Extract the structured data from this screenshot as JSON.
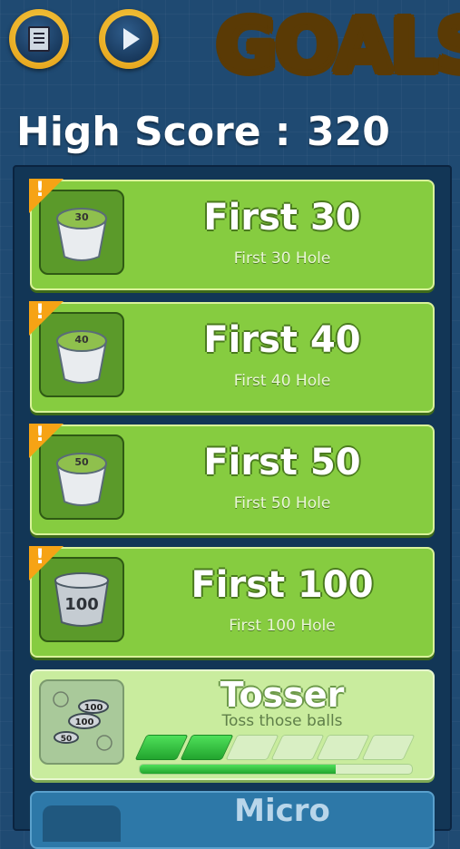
{
  "header": {
    "logo_text": "GOALS",
    "menu_button_icon": "menu-list-icon",
    "play_button_icon": "play-icon"
  },
  "high_score": {
    "label": "High Score :",
    "value": "320"
  },
  "achievements": [
    {
      "title": "First 30",
      "subtitle": "First 30 Hole",
      "bucket_label": "30",
      "new": true
    },
    {
      "title": "First 40",
      "subtitle": "First 40 Hole",
      "bucket_label": "40",
      "new": true
    },
    {
      "title": "First 50",
      "subtitle": "First 50 Hole",
      "bucket_label": "50",
      "new": true
    },
    {
      "title": "First 100",
      "subtitle": "First 100 Hole",
      "bucket_label": "100",
      "new": true
    },
    {
      "title": "Tosser",
      "subtitle": "Toss those balls",
      "icon_labels": [
        "100",
        "100",
        "50"
      ],
      "segments_total": 6,
      "segments_filled": 2,
      "progress_fraction": 0.72
    },
    {
      "title": "Micro"
    }
  ],
  "colors": {
    "background": "#1f4a72",
    "card_green": "#86cc40",
    "card_light": "#c9ec9e",
    "badge_orange": "#f6a315",
    "logo_yellow": "#f7b500"
  }
}
